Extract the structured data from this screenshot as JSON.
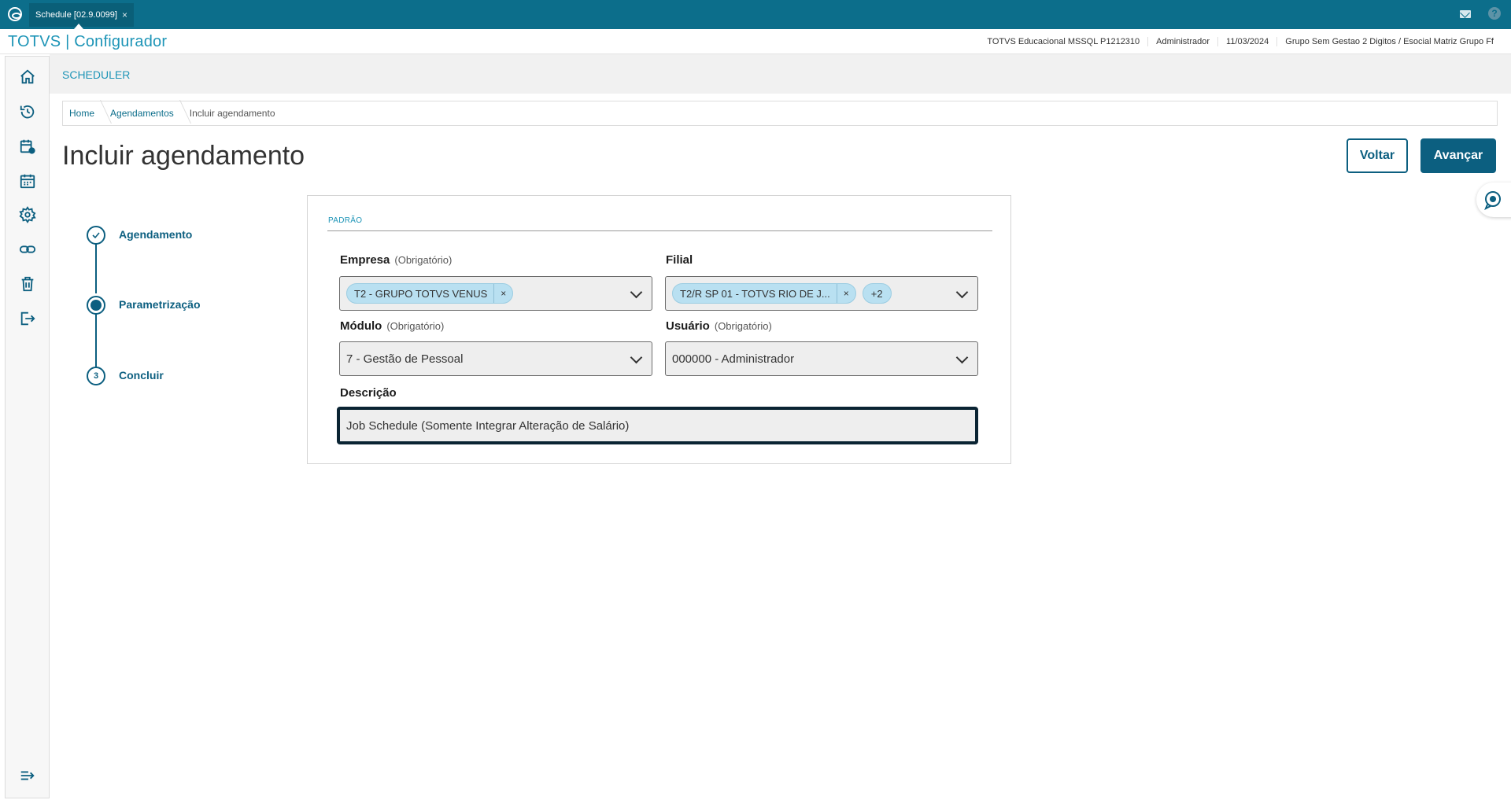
{
  "window": {
    "tab_title": "Schedule [02.9.0099]",
    "tab_close": "×"
  },
  "header": {
    "brand": "TOTVS | Configurador",
    "environment": "TOTVS Educacional MSSQL P1212310",
    "user": "Administrador",
    "date": "11/03/2024",
    "company": "Grupo Sem Gestao 2 Digitos / Esocial Matriz Grupo Ff"
  },
  "sidebar": {
    "items": [
      {
        "icon": "home-icon"
      },
      {
        "icon": "history-icon"
      },
      {
        "icon": "calendar-settings-icon"
      },
      {
        "icon": "calendar-icon"
      },
      {
        "icon": "gear-icon"
      },
      {
        "icon": "link-icon"
      },
      {
        "icon": "trash-icon"
      },
      {
        "icon": "logout-icon"
      }
    ],
    "collapse_icon": "expand-menu-icon"
  },
  "page": {
    "module_title": "SCHEDULER",
    "breadcrumb": [
      "Home",
      "Agendamentos",
      "Incluir agendamento"
    ],
    "title": "Incluir agendamento",
    "back_label": "Voltar",
    "next_label": "Avançar"
  },
  "stepper": {
    "steps": [
      {
        "label": "Agendamento",
        "state": "done"
      },
      {
        "label": "Parametrização",
        "state": "active"
      },
      {
        "label": "Concluir",
        "state": "pending",
        "number": "3"
      }
    ]
  },
  "form": {
    "section": "PADRÃO",
    "empresa": {
      "label": "Empresa",
      "required": "(Obrigatório)",
      "chips": [
        "T2 - GRUPO TOTVS VENUS"
      ],
      "chip_close": "×"
    },
    "filial": {
      "label": "Filial",
      "chips": [
        "T2/R SP 01 - TOTVS RIO DE J..."
      ],
      "chip_close": "×",
      "more": "+2"
    },
    "modulo": {
      "label": "Módulo",
      "required": "(Obrigatório)",
      "value": "7 - Gestão de Pessoal"
    },
    "usuario": {
      "label": "Usuário",
      "required": "(Obrigatório)",
      "value": "000000 - Administrador"
    },
    "descricao": {
      "label": "Descrição",
      "value": "Job Schedule (Somente Integrar Alteração de Salário)"
    }
  },
  "colors": {
    "titlebar": "#0c6e8b",
    "brand": "#1e95b7",
    "primary": "#0c5f80",
    "chip": "#b9e0f1"
  }
}
